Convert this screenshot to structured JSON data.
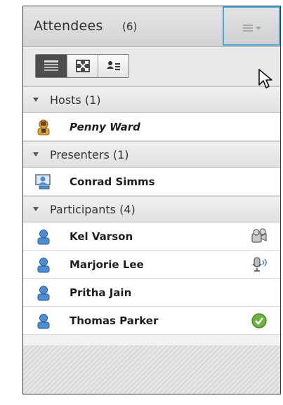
{
  "header": {
    "title": "Attendees",
    "count": "(6)",
    "menu_icon": "pod-menu-icon"
  },
  "toolbar": {
    "views": [
      {
        "name": "list-view",
        "icon": "list-view-icon",
        "active": true
      },
      {
        "name": "breakout-view",
        "icon": "breakout-view-icon",
        "active": false
      },
      {
        "name": "status-view",
        "icon": "attendee-status-icon",
        "active": false
      }
    ]
  },
  "sections": {
    "hosts": {
      "label": "Hosts (1)",
      "people": [
        {
          "name": "Penny Ward",
          "role_icon": "host-icon",
          "status_icon": ""
        }
      ]
    },
    "presenters": {
      "label": "Presenters (1)",
      "people": [
        {
          "name": "Conrad Simms",
          "role_icon": "presenter-icon",
          "status_icon": ""
        }
      ]
    },
    "participants": {
      "label": "Participants (4)",
      "people": [
        {
          "name": "Kel Varson",
          "role_icon": "participant-icon",
          "status_icon": "video-camera-icon"
        },
        {
          "name": "Marjorie Lee",
          "role_icon": "participant-icon",
          "status_icon": "microphone-active-icon"
        },
        {
          "name": "Pritha Jain",
          "role_icon": "participant-icon",
          "status_icon": ""
        },
        {
          "name": "Thomas Parker",
          "role_icon": "participant-icon",
          "status_icon": "agree-check-icon"
        }
      ]
    }
  },
  "colors": {
    "focus_outline": "#47a7d8",
    "participant_blue": "#4a8fd6",
    "host_orange": "#e5a233",
    "check_green": "#6cb33f"
  }
}
